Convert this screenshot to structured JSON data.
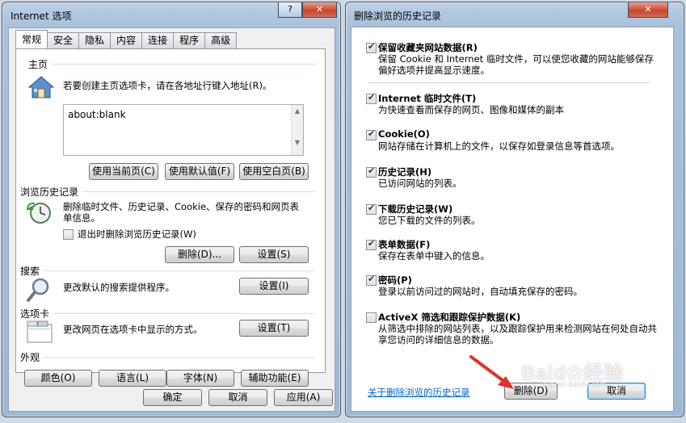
{
  "ie_options": {
    "title": "Internet 选项",
    "tabs": [
      "常规",
      "安全",
      "隐私",
      "内容",
      "连接",
      "程序",
      "高级"
    ],
    "homepage": {
      "heading": "主页",
      "description": "若要创建主页选项卡，请在各地址行键入地址(R)。",
      "url": "about:blank",
      "buttons": [
        "使用当前页(C)",
        "使用默认值(F)",
        "使用空白页(B)"
      ]
    },
    "history": {
      "heading": "浏览历史记录",
      "description": "删除临时文件、历史记录、Cookie、保存的密码和网页表单信息。",
      "checkbox_label": "退出时删除浏览历史记录(W)",
      "delete_button": "删除(D)...",
      "settings_button": "设置(S)"
    },
    "search": {
      "heading": "搜索",
      "description": "更改默认的搜索提供程序。",
      "settings_button": "设置(I)"
    },
    "tabs_section": {
      "heading": "选项卡",
      "description": "更改网页在选项卡中显示的方式。",
      "settings_button": "设置(T)"
    },
    "appearance": {
      "heading": "外观",
      "buttons": [
        "颜色(O)",
        "语言(L)",
        "字体(N)",
        "辅助功能(E)"
      ]
    },
    "footer": {
      "ok": "确定",
      "cancel": "取消",
      "apply": "应用(A)"
    }
  },
  "delete_history": {
    "title": "删除浏览的历史记录",
    "options": [
      {
        "title": "保留收藏夹网站数据(R)",
        "desc": "保留 Cookie 和 Internet 临时文件，可以使您收藏的网站能够保存偏好选项并提高显示速度。",
        "checked": true
      },
      {
        "title": "Internet 临时文件(T)",
        "desc": "为快速查看而保存的网页、图像和媒体的副本",
        "checked": true
      },
      {
        "title": "Cookie(O)",
        "desc": "网站存储在计算机上的文件，以保存如登录信息等首选项。",
        "checked": true
      },
      {
        "title": "历史记录(H)",
        "desc": "已访问网站的列表。",
        "checked": true
      },
      {
        "title": "下载历史记录(W)",
        "desc": "您已下载的文件的列表。",
        "checked": true
      },
      {
        "title": "表单数据(F)",
        "desc": "保存在表单中键入的信息。",
        "checked": true
      },
      {
        "title": "密码(P)",
        "desc": "登录以前访问过的网站时，自动填充保存的密码。",
        "checked": true
      },
      {
        "title": "ActiveX 筛选和跟踪保护数据(K)",
        "desc": "从筛选中排除的网站列表，以及跟踪保护用来检测网站在何处自动共享您访问的详细信息的数据。",
        "checked": false
      }
    ],
    "about_link": "关于删除浏览的历史记录",
    "delete_button": "删除(D)",
    "cancel_button": "取消"
  },
  "watermark": "Baidu经验 jingyan.baidu.com",
  "colors": {
    "accent_arrow": "#e0322a",
    "link": "#0066cc"
  }
}
